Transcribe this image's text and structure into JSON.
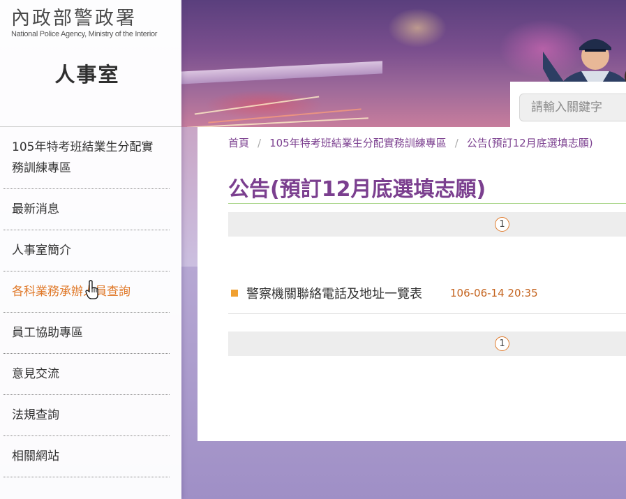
{
  "header": {
    "logo_zh": "內政部警政署",
    "logo_en": "National Police Agency, Ministry of the Interior",
    "unit_title": "人事室"
  },
  "search": {
    "placeholder": "請輸入關鍵字"
  },
  "sidebar": {
    "items": [
      {
        "label": "105年特考班結業生分配實務訓練專區",
        "active": false
      },
      {
        "label": "最新消息",
        "active": false
      },
      {
        "label": "人事室簡介",
        "active": false
      },
      {
        "label": "各科業務承辦人員查詢",
        "active": true
      },
      {
        "label": "員工協助專區",
        "active": false
      },
      {
        "label": "意見交流",
        "active": false
      },
      {
        "label": "法規查詢",
        "active": false
      },
      {
        "label": "相關網站",
        "active": false
      }
    ]
  },
  "breadcrumb": {
    "home": "首頁",
    "section": "105年特考班結業生分配實務訓練專區",
    "current": "公告(預訂12月底選填志願)",
    "separator": "/"
  },
  "main": {
    "title": "公告(預訂12月底選填志願)",
    "pager_top": "1",
    "pager_bottom": "1",
    "items": [
      {
        "title": "警察機關聯絡電話及地址一覽表",
        "date": "106-06-14 20:35"
      }
    ]
  },
  "colors": {
    "accent_purple": "#7b3f8f",
    "active_orange": "#e07a2b",
    "date_orange": "#c4631e",
    "bullet_orange": "#f0a030"
  }
}
